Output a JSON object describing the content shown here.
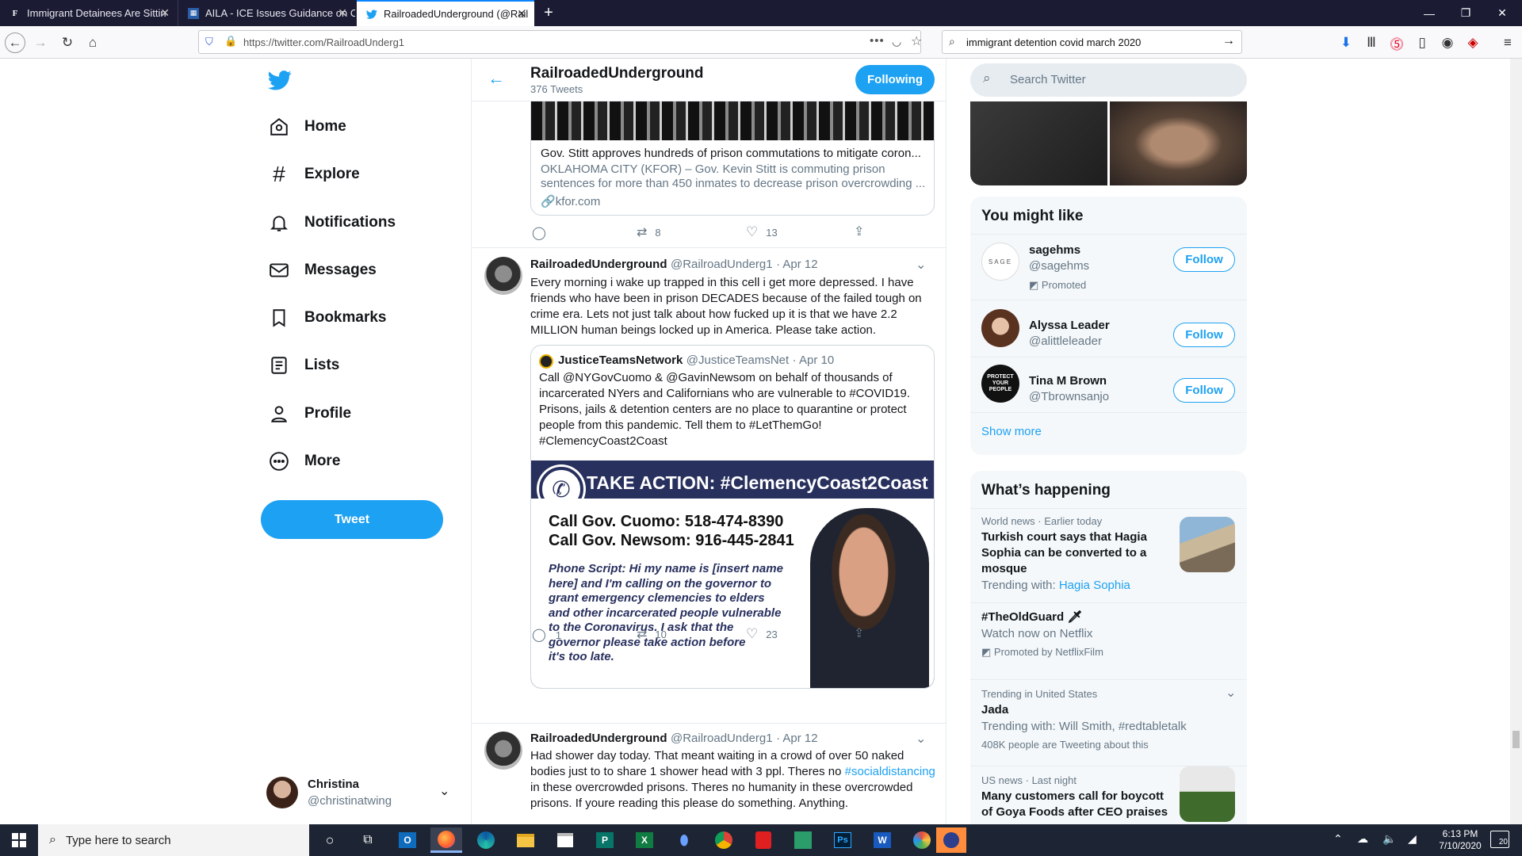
{
  "browser": {
    "tabs": [
      {
        "label": "Immigrant Detainees Are Sittin",
        "favicon": "F",
        "active": false
      },
      {
        "label": "AILA - ICE Issues Guidance on C",
        "favicon": "A",
        "active": false
      },
      {
        "label": "RailroadedUnderground (@Rail",
        "favicon": "bird",
        "active": true
      }
    ],
    "url": "https://twitter.com/RailroadUnderg1",
    "search_value": "immigrant detention covid march 2020"
  },
  "nav": {
    "items": [
      {
        "label": "Home",
        "icon": "home-icon"
      },
      {
        "label": "Explore",
        "icon": "hashtag-icon"
      },
      {
        "label": "Notifications",
        "icon": "bell-icon"
      },
      {
        "label": "Messages",
        "icon": "envelope-icon"
      },
      {
        "label": "Bookmarks",
        "icon": "bookmark-icon"
      },
      {
        "label": "Lists",
        "icon": "list-icon"
      },
      {
        "label": "Profile",
        "icon": "person-icon"
      },
      {
        "label": "More",
        "icon": "more-icon"
      }
    ],
    "tweet_button": "Tweet",
    "account": {
      "name": "Christina",
      "handle": "@christinatwing"
    }
  },
  "profile_header": {
    "name": "RailroadedUnderground",
    "tweet_count": "376 Tweets",
    "follow_state": "Following"
  },
  "link_card": {
    "title": "Gov. Stitt approves hundreds of prison commutations to mitigate coron...",
    "desc_line1": "OKLAHOMA CITY (KFOR) – Gov. Kevin Stitt is commuting prison",
    "desc_line2": "sentences for more than 450 inmates to decrease prison overcrowding ...",
    "domain": "kfor.com",
    "retweets": "8",
    "likes": "13"
  },
  "tweets": [
    {
      "name": "RailroadedUnderground",
      "handle": "@RailroadUnderg1",
      "date": "· Apr 12",
      "lines": [
        "Every morning i wake up trapped in this cell i get more depressed. I have",
        "friends who have been in prison DECADES because of the failed tough on",
        "crime era. Lets not just talk about how fucked up it is that we have 2.2",
        "MILLION human beings locked up in America. Please take action."
      ],
      "quote": {
        "name": "JusticeTeamsNetwork",
        "handle": "@JusticeTeamsNet",
        "date": "· Apr 10",
        "lines": [
          "Call @NYGovCuomo & @GavinNewsom on behalf of thousands of",
          "incarcerated NYers and Californians who are vulnerable to #COVID19.",
          "Prisons, jails & detention centers are no place to quarantine or protect",
          "people from this pandemic. Tell them to #LetThemGo!",
          "#ClemencyCoast2Coast"
        ],
        "image": {
          "headline": "TAKE ACTION: #ClemencyCoast2Coast",
          "call1": "Call Gov. Cuomo: 518-474-8390",
          "call2": "Call Gov. Newsom: 916-445-2841",
          "script_lines": [
            "Phone Script: Hi my name is [insert name",
            "here] and I'm calling on the governor to",
            "grant emergency clemencies to elders",
            "and other incarcerated people vulnerable",
            "to the Coronavirus. I ask that the",
            "governor please take action before",
            "it's too late."
          ]
        }
      },
      "replies": "1",
      "retweets": "10",
      "likes": "23"
    },
    {
      "name": "RailroadedUnderground",
      "handle": "@RailroadUnderg1",
      "date": "· Apr 12",
      "line1_pre": "Had shower day today. That meant waiting in a crowd of over 50 naked",
      "line2_pre": "bodies just to to share 1 shower head with 3 ppl. Theres no ",
      "line2_link": "#socialdistancing",
      "line3": "in these overcrowded prisons. Theres no humanity in these overcrowded",
      "line4": "prisons. If youre reading this please do something. Anything."
    }
  ],
  "sidebar": {
    "search_placeholder": "Search Twitter",
    "might_like_title": "You might like",
    "suggestions": [
      {
        "name": "sagehms",
        "handle": "@sagehms",
        "note": "Promoted",
        "button": "Follow",
        "avatar_text": "SAGE"
      },
      {
        "name": "Alyssa Leader",
        "handle": "@alittleleader",
        "note": "",
        "button": "Follow",
        "avatar_text": ""
      },
      {
        "name": "Tina M Brown",
        "handle": "@Tbrownsanjo",
        "note": "",
        "button": "Follow",
        "avatar_text": "PROTECT YOUR PEOPLE"
      }
    ],
    "show_more": "Show more",
    "happening_title": "What’s happening",
    "trends": [
      {
        "meta": "World news · Earlier today",
        "title_lines": [
          "Turkish court says that Hagia",
          "Sophia can be converted to a",
          "mosque"
        ],
        "extra_pre": "Trending with: ",
        "extra_link": "Hagia Sophia"
      },
      {
        "meta": "",
        "title_lines": [
          "#TheOldGuard"
        ],
        "extra_pre": "Watch now on Netflix",
        "extra_link": "",
        "promo": "Promoted by NetflixFilm"
      },
      {
        "meta": "Trending in United States",
        "title_lines": [
          "Jada"
        ],
        "extra_pre": "Trending with: Will Smith, #redtabletalk",
        "extra_link": "",
        "promo": "408K people are Tweeting about this"
      },
      {
        "meta": "US news · Last night",
        "title_lines": [
          "Many customers call for boycott",
          "of Goya Foods after CEO praises"
        ],
        "extra_pre": "",
        "extra_link": ""
      }
    ]
  },
  "taskbar": {
    "search_placeholder": "Type here to search",
    "time": "6:13 PM",
    "date": "7/10/2020",
    "notif_count": "20"
  },
  "colors": {
    "accent": "#1da1f2",
    "tabbar": "#1b1b34",
    "taskbar": "#1d2434"
  }
}
